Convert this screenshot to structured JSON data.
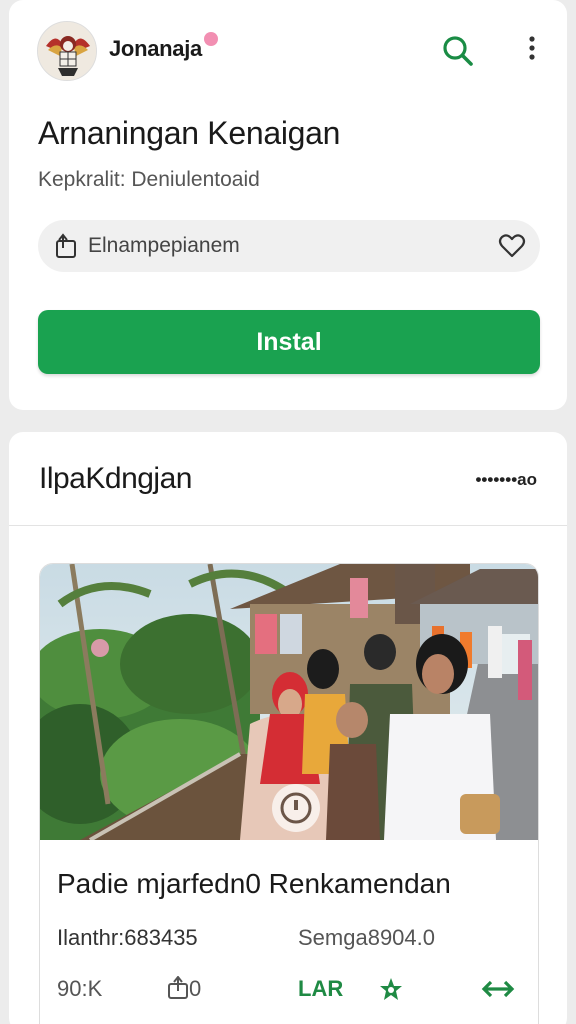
{
  "header": {
    "app_name": "Jonanaja",
    "search_icon": "search-icon",
    "more_icon": "more-vertical-icon"
  },
  "app": {
    "title": "Arnaningan Kenaigan",
    "subtitle": "Kepkralit: Deniulentoaid",
    "pill_label": "Elnampepianem",
    "install_label": "Instal",
    "accent_color": "#1aa250"
  },
  "recommendations": {
    "section_title": "IlpaKdngjan",
    "more_label": "•••••••ao",
    "item": {
      "title": "Padie mjarfedn0 Renkamendan",
      "meta_left": "Ilanthr:683435",
      "meta_right": "Semga8904.0",
      "downloads": "90:K",
      "shares": "0",
      "tag": "LAR",
      "star_icon": "star-icon",
      "arrow_icon": "double-arrow-icon"
    }
  }
}
